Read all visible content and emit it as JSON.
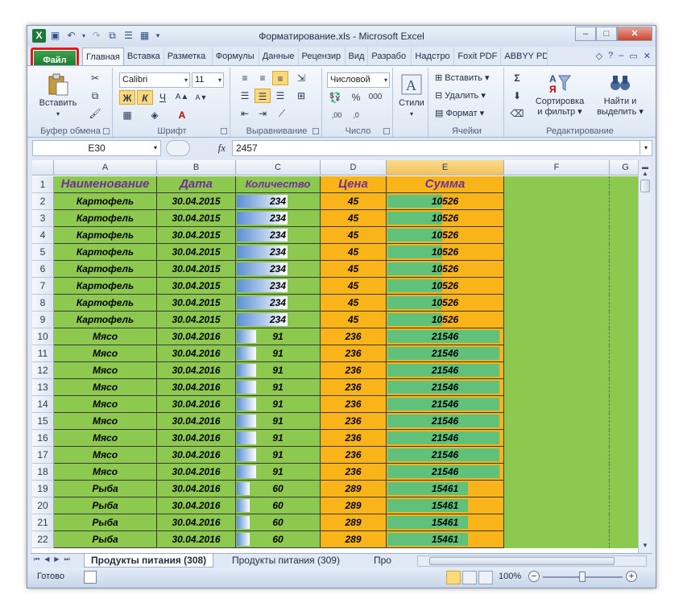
{
  "window": {
    "title": "Форматирование.xls - Microsoft Excel"
  },
  "ribbon_tabs": [
    "Главная",
    "Вставка",
    "Разметка",
    "Формулы",
    "Данные",
    "Рецензир",
    "Вид",
    "Разрабо",
    "Надстро",
    "Foxit PDF",
    "ABBYY PD"
  ],
  "file_tab": "Файл",
  "clipboard": {
    "paste": "Вставить",
    "label": "Буфер обмена"
  },
  "font": {
    "name": "Calibri",
    "size": "11",
    "label": "Шрифт",
    "bold": "Ж",
    "italic": "К",
    "underline": "Ч"
  },
  "alignment": {
    "label": "Выравнивание"
  },
  "number": {
    "format": "Числовой",
    "label": "Число"
  },
  "styles": {
    "label": "Стили"
  },
  "cells": {
    "insert": "Вставить",
    "delete": "Удалить",
    "format": "Формат",
    "label": "Ячейки"
  },
  "editing": {
    "sort_line1": "Сортировка",
    "sort_line2": "и фильтр",
    "find_line1": "Найти и",
    "find_line2": "выделить",
    "label": "Редактирование"
  },
  "formula_bar": {
    "name_box": "E30",
    "fx": "fx",
    "value": "2457"
  },
  "columns": [
    "A",
    "B",
    "C",
    "D",
    "E",
    "F",
    "G"
  ],
  "header_row": {
    "num": "1",
    "a": "Наименование",
    "b": "Дата",
    "c": "Количество",
    "d": "Цена",
    "e": "Сумма"
  },
  "rows": [
    {
      "num": "2",
      "a": "Картофель",
      "b": "30.04.2015",
      "c": "234",
      "d": "45",
      "e": "10526"
    },
    {
      "num": "3",
      "a": "Картофель",
      "b": "30.04.2015",
      "c": "234",
      "d": "45",
      "e": "10526"
    },
    {
      "num": "4",
      "a": "Картофель",
      "b": "30.04.2015",
      "c": "234",
      "d": "45",
      "e": "10526"
    },
    {
      "num": "5",
      "a": "Картофель",
      "b": "30.04.2015",
      "c": "234",
      "d": "45",
      "e": "10526"
    },
    {
      "num": "6",
      "a": "Картофель",
      "b": "30.04.2015",
      "c": "234",
      "d": "45",
      "e": "10526"
    },
    {
      "num": "7",
      "a": "Картофель",
      "b": "30.04.2015",
      "c": "234",
      "d": "45",
      "e": "10526"
    },
    {
      "num": "8",
      "a": "Картофель",
      "b": "30.04.2015",
      "c": "234",
      "d": "45",
      "e": "10526"
    },
    {
      "num": "9",
      "a": "Картофель",
      "b": "30.04.2015",
      "c": "234",
      "d": "45",
      "e": "10526"
    },
    {
      "num": "10",
      "a": "Мясо",
      "b": "30.04.2016",
      "c": "91",
      "d": "236",
      "e": "21546"
    },
    {
      "num": "11",
      "a": "Мясо",
      "b": "30.04.2016",
      "c": "91",
      "d": "236",
      "e": "21546"
    },
    {
      "num": "12",
      "a": "Мясо",
      "b": "30.04.2016",
      "c": "91",
      "d": "236",
      "e": "21546"
    },
    {
      "num": "13",
      "a": "Мясо",
      "b": "30.04.2016",
      "c": "91",
      "d": "236",
      "e": "21546"
    },
    {
      "num": "14",
      "a": "Мясо",
      "b": "30.04.2016",
      "c": "91",
      "d": "236",
      "e": "21546"
    },
    {
      "num": "15",
      "a": "Мясо",
      "b": "30.04.2016",
      "c": "91",
      "d": "236",
      "e": "21546"
    },
    {
      "num": "16",
      "a": "Мясо",
      "b": "30.04.2016",
      "c": "91",
      "d": "236",
      "e": "21546"
    },
    {
      "num": "17",
      "a": "Мясо",
      "b": "30.04.2016",
      "c": "91",
      "d": "236",
      "e": "21546"
    },
    {
      "num": "18",
      "a": "Мясо",
      "b": "30.04.2016",
      "c": "91",
      "d": "236",
      "e": "21546"
    },
    {
      "num": "19",
      "a": "Рыба",
      "b": "30.04.2016",
      "c": "60",
      "d": "289",
      "e": "15461"
    },
    {
      "num": "20",
      "a": "Рыба",
      "b": "30.04.2016",
      "c": "60",
      "d": "289",
      "e": "15461"
    },
    {
      "num": "21",
      "a": "Рыба",
      "b": "30.04.2016",
      "c": "60",
      "d": "289",
      "e": "15461"
    },
    {
      "num": "22",
      "a": "Рыба",
      "b": "30.04.2016",
      "c": "60",
      "d": "289",
      "e": "15461"
    }
  ],
  "databar_max": {
    "c": 234,
    "e": 21546
  },
  "sheets": [
    "Продукты питания (308)",
    "Продукты питания (309)",
    "Про"
  ],
  "status": {
    "ready": "Готово",
    "zoom": "100%"
  },
  "colors": {
    "green_fill": "#8dc94e",
    "orange_fill": "#f8b418",
    "header_text": "#703098",
    "file_tab": "#2e9140",
    "highlight_ring": "#e0191a"
  }
}
